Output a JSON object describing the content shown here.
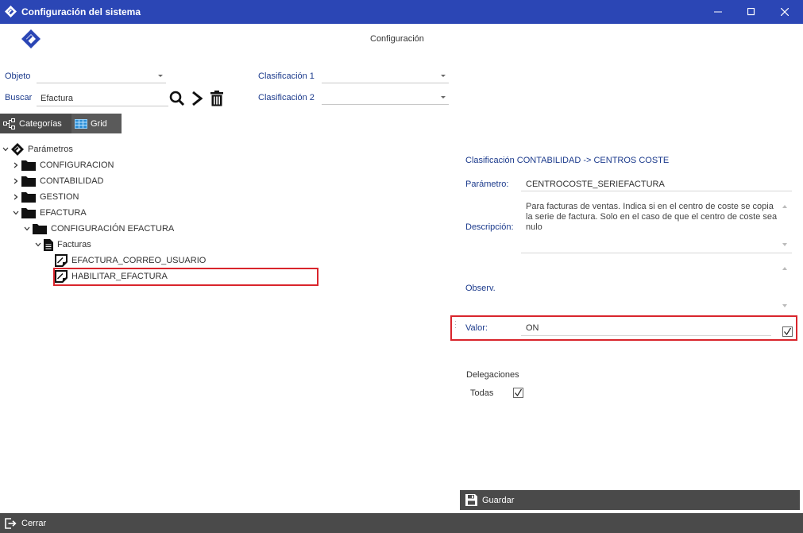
{
  "window": {
    "title": "Configuración del sistema"
  },
  "header": {
    "title": "Configuración"
  },
  "filters": {
    "objeto_label": "Objeto",
    "objeto_value": "",
    "buscar_label": "Buscar",
    "buscar_value": "Efactura",
    "clasificacion1_label": "Clasificación 1",
    "clasificacion1_value": "",
    "clasificacion2_label": "Clasificación 2",
    "clasificacion2_value": ""
  },
  "views": {
    "categorias": "Categorías",
    "grid": "Grid"
  },
  "tree": {
    "root": "Parámetros",
    "configuracion": "CONFIGURACION",
    "contabilidad": "CONTABILIDAD",
    "gestion": "GESTION",
    "efactura": "EFACTURA",
    "config_efactura": "CONFIGURACIÓN EFACTURA",
    "facturas": "Facturas",
    "correo_usuario": "EFACTURA_CORREO_USUARIO",
    "habilitar": "HABILITAR_EFACTURA"
  },
  "detail": {
    "classification": "Clasificación CONTABILIDAD -> CENTROS COSTE",
    "parametro_label": "Parámetro:",
    "parametro_value": "CENTROCOSTE_SERIEFACTURA",
    "descripcion_label": "Descripción:",
    "descripcion_value": "Para facturas de ventas. Indica si en el centro de coste se copia la serie de factura. Solo en el caso de que el centro de coste sea nulo",
    "observ_label": "Observ.",
    "observ_value": "",
    "valor_label": "Valor:",
    "valor_value": "ON",
    "valor_checked": true,
    "delegaciones_label": "Delegaciones",
    "todas_label": "Todas",
    "todas_checked": true
  },
  "actions": {
    "guardar": "Guardar",
    "cerrar": "Cerrar"
  },
  "colors": {
    "titlebar": "#2b46b5",
    "label_blue": "#1b3a8c",
    "highlight_red": "#d9252c",
    "bar_dark": "#4a4a4a"
  }
}
